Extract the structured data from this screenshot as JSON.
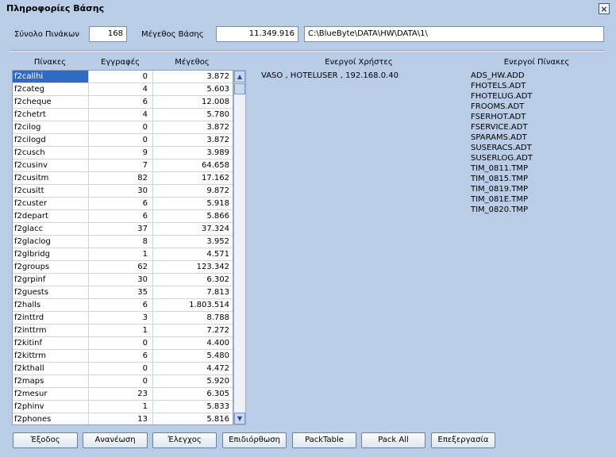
{
  "window": {
    "title": "Πληροφορίες Βάσης"
  },
  "summary": {
    "tables_count_label": "Σύνολο Πινάκων",
    "tables_count": "168",
    "db_size_label": "Μέγεθος Βάσης",
    "db_size": "11.349.916",
    "db_path": "C:\\BlueByte\\DATA\\HW\\DATA\\1\\"
  },
  "grid": {
    "headers": [
      "Πίνακες",
      "Εγγραφές",
      "Μέγεθος"
    ],
    "rows": [
      [
        "f2callhi",
        "0",
        "3.872"
      ],
      [
        "f2categ",
        "4",
        "5.603"
      ],
      [
        "f2cheque",
        "6",
        "12.008"
      ],
      [
        "f2chetrt",
        "4",
        "5.780"
      ],
      [
        "f2cilog",
        "0",
        "3.872"
      ],
      [
        "f2cilogd",
        "0",
        "3.872"
      ],
      [
        "f2cusch",
        "9",
        "3.989"
      ],
      [
        "f2cusinv",
        "7",
        "64.658"
      ],
      [
        "f2cusitm",
        "82",
        "17.162"
      ],
      [
        "f2cusitt",
        "30",
        "9.872"
      ],
      [
        "f2custer",
        "6",
        "5.918"
      ],
      [
        "f2depart",
        "6",
        "5.866"
      ],
      [
        "f2glacc",
        "37",
        "37.324"
      ],
      [
        "f2glaclog",
        "8",
        "3.952"
      ],
      [
        "f2glbridg",
        "1",
        "4.571"
      ],
      [
        "f2groups",
        "62",
        "123.342"
      ],
      [
        "f2grpinf",
        "30",
        "6.302"
      ],
      [
        "f2guests",
        "35",
        "7.813"
      ],
      [
        "f2halls",
        "6",
        "1.803.514"
      ],
      [
        "f2inttrd",
        "3",
        "8.788"
      ],
      [
        "f2inttrm",
        "1",
        "7.272"
      ],
      [
        "f2kitinf",
        "0",
        "4.400"
      ],
      [
        "f2kittrm",
        "6",
        "5.480"
      ],
      [
        "f2kthall",
        "0",
        "4.472"
      ],
      [
        "f2maps",
        "0",
        "5.920"
      ],
      [
        "f2mesur",
        "23",
        "6.305"
      ],
      [
        "f2phinv",
        "1",
        "5.833"
      ],
      [
        "f2phones",
        "13",
        "5.816"
      ]
    ]
  },
  "active_users": {
    "header": "Ενεργοί Χρήστες",
    "items": [
      "VASO , HOTELUSER , 192.168.0.40"
    ]
  },
  "active_tables": {
    "header": "Ενεργοί Πίνακες",
    "items": [
      "ADS_HW.ADD",
      "FHOTELS.ADT",
      "FHOTELUG.ADT",
      "FROOMS.ADT",
      "FSERHOT.ADT",
      "FSERVICE.ADT",
      "SPARAMS.ADT",
      "SUSERACS.ADT",
      "SUSERLOG.ADT",
      "TIM_0811.TMP",
      "TIM_0815.TMP",
      "TIM_0819.TMP",
      "TIM_081E.TMP",
      "TIM_0820.TMP"
    ]
  },
  "buttons": {
    "exit": "Έξοδος",
    "refresh": "Ανανέωση",
    "check": "Έλεγχος",
    "repair": "Επιδιόρθωση",
    "pack_table": "PackTable",
    "pack_all": "Pack All",
    "process": "Επεξεργασία"
  }
}
